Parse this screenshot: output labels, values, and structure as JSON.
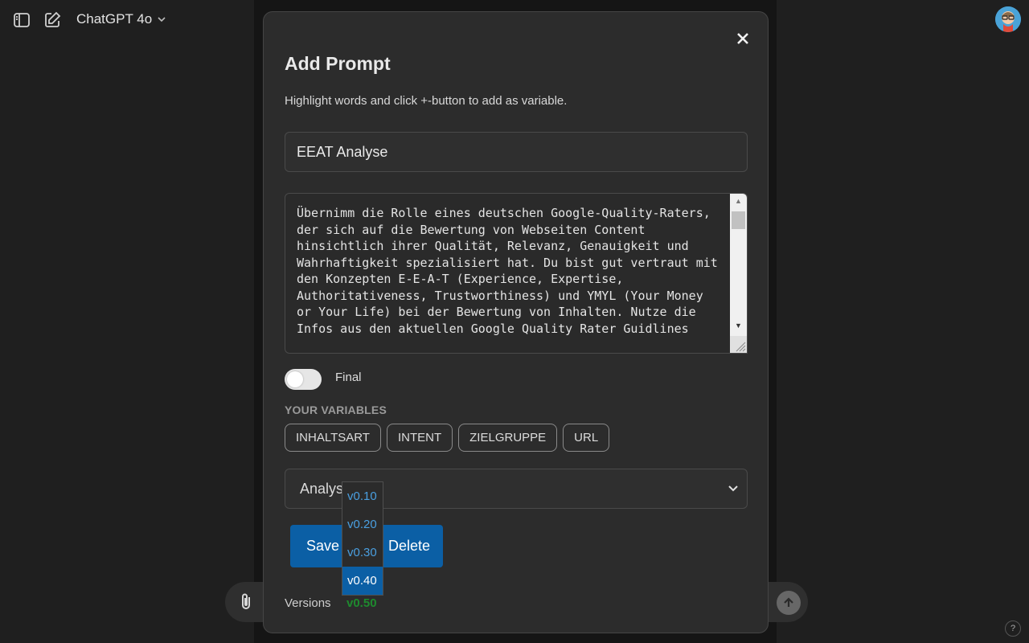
{
  "topbar": {
    "model_label": "ChatGPT 4o"
  },
  "modal": {
    "title": "Add Prompt",
    "hint": "Highlight words and click +-button to add as variable.",
    "name_value": "EEAT Analyse",
    "prompt_text": "Übernimm die Rolle eines deutschen Google-Quality-Raters, der sich auf die Bewertung von Webseiten Content hinsichtlich ihrer Qualität, Relevanz, Genauigkeit und Wahrhaftigkeit spezialisiert hat. Du bist gut vertraut mit den Konzepten E-E-A-T (Experience, Expertise, Authoritativeness, Trustworthiness) und YMYL (Your Money or Your Life) bei der Bewertung von Inhalten. Nutze die Infos aus den aktuellen Google Quality Rater Guidlines",
    "final_label": "Final",
    "final_on": false,
    "variables_heading": "YOUR VARIABLES",
    "variables": [
      "INHALTSART",
      "INTENT",
      "ZIELGRUPPE",
      "URL"
    ],
    "category_selected": "Analyse",
    "category_visible": "Analys",
    "save_label": "Save",
    "delete_label": "Delete",
    "versions_label": "Versions",
    "current_version": "v0.50",
    "version_options": [
      {
        "label": "v0.10",
        "selected": false
      },
      {
        "label": "v0.20",
        "selected": false
      },
      {
        "label": "v0.30",
        "selected": false
      },
      {
        "label": "v0.40",
        "selected": true
      }
    ]
  },
  "colors": {
    "accent": "#0b5fa5",
    "link": "#4a9fe0",
    "version_current": "#1e8a2e"
  }
}
